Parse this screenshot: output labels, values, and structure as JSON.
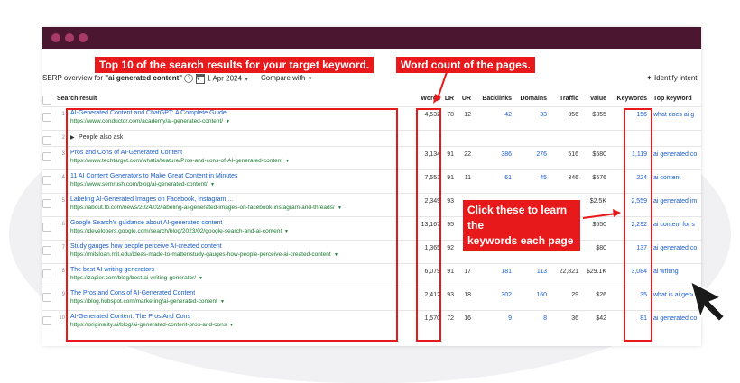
{
  "header": {
    "overview_prefix": "SERP overview for ",
    "keyword": "\"ai generated content\"",
    "date": "1 Apr 2024",
    "compare_label": "Compare with",
    "identify_label": "Identify intent"
  },
  "columns": {
    "search_result": "Search result",
    "words": "Words",
    "dr": "DR",
    "ur": "UR",
    "backlinks": "Backlinks",
    "domains": "Domains",
    "traffic": "Traffic",
    "value": "Value",
    "keywords": "Keywords",
    "top_keyword": "Top keyword"
  },
  "rows": [
    {
      "pos": "1",
      "title": "AI-Generated Content and ChatGPT: A Complete Guide",
      "url": "https://www.conductor.com/academy/ai-generated-content/",
      "words": "4,532",
      "dr": "78",
      "ur": "12",
      "backlinks": "42",
      "domains": "33",
      "traffic": "356",
      "value": "$355",
      "keywords": "156",
      "top": "what does ai g"
    },
    {
      "pos": "2",
      "title": "People also ask",
      "special": true
    },
    {
      "pos": "3",
      "title": "Pros and Cons of AI-Generated Content",
      "url": "https://www.techtarget.com/whatis/feature/Pros-and-cons-of-AI-generated-content",
      "words": "3,134",
      "dr": "91",
      "ur": "22",
      "backlinks": "386",
      "domains": "276",
      "traffic": "516",
      "value": "$580",
      "keywords": "1,119",
      "top": "ai generated co"
    },
    {
      "pos": "4",
      "title": "11 AI Content Generators to Make Great Content in Minutes",
      "url": "https://www.semrush.com/blog/ai-generated-content/",
      "words": "7,551",
      "dr": "91",
      "ur": "11",
      "backlinks": "61",
      "domains": "45",
      "traffic": "346",
      "value": "$576",
      "keywords": "224",
      "top": "ai content"
    },
    {
      "pos": "5",
      "title": "Labeling AI-Generated Images on Facebook, Instagram ...",
      "url": "https://about.fb.com/news/2024/02/labeling-ai-generated-images-on-facebook-instagram-and-threads/",
      "words": "2,349",
      "dr": "93",
      "ur": "",
      "backlinks": "",
      "domains": "",
      "traffic": "",
      "value": "$2.5K",
      "keywords": "2,559",
      "top": "ai generated im"
    },
    {
      "pos": "6",
      "title": "Google Search's guidance about AI-generated content",
      "url": "https://developers.google.com/search/blog/2023/02/google-search-and-ai-content",
      "words": "13,167",
      "dr": "95",
      "ur": "",
      "backlinks": "",
      "domains": "",
      "traffic": "",
      "value": "$550",
      "keywords": "2,292",
      "top": "ai content for s"
    },
    {
      "pos": "7",
      "title": "Study gauges how people perceive AI-created content",
      "url": "https://mitsloan.mit.edu/ideas-made-to-matter/study-gauges-how-people-perceive-ai-created-content",
      "words": "1,365",
      "dr": "92",
      "ur": "15",
      "backlinks": "229",
      "domains": "60",
      "traffic": "64",
      "value": "$80",
      "keywords": "137",
      "top": "ai generated co"
    },
    {
      "pos": "8",
      "title": "The best AI writing generators",
      "url": "https://zapier.com/blog/best-ai-writing-generator/",
      "words": "6,079",
      "dr": "91",
      "ur": "17",
      "backlinks": "181",
      "domains": "113",
      "traffic": "22,821",
      "value": "$29.1K",
      "keywords": "3,084",
      "top": "ai writing"
    },
    {
      "pos": "9",
      "title": "The Pros and Cons of AI-Generated Content",
      "url": "https://blog.hubspot.com/marketing/ai-generated-content",
      "words": "2,412",
      "dr": "93",
      "ur": "18",
      "backlinks": "302",
      "domains": "160",
      "traffic": "29",
      "value": "$26",
      "keywords": "35",
      "top": "what is ai gene"
    },
    {
      "pos": "10",
      "title": "AI-Generated Content: The Pros And Cons",
      "url": "https://originality.ai/blog/ai-generated-content-pros-and-cons",
      "words": "1,570",
      "dr": "72",
      "ur": "16",
      "backlinks": "9",
      "domains": "8",
      "traffic": "36",
      "value": "$42",
      "keywords": "81",
      "top": "ai generated co"
    }
  ],
  "annotations": {
    "top10": "Top 10 of the search results for your target keyword.",
    "wordcount": "Word count of the pages.",
    "callout_line1": "Click these to learn the",
    "callout_line2": "keywords each page",
    "callout_line3": "is ranking for."
  },
  "colors": {
    "accent_red": "#e8191b",
    "titlebar": "#4b1630",
    "link": "#1b5cc8",
    "url": "#1a7a30"
  },
  "icons": [
    "help-icon",
    "calendar-icon",
    "chevron-down-icon",
    "sparkle-icon",
    "cursor-arrow-icon",
    "expand-triangle-icon"
  ]
}
